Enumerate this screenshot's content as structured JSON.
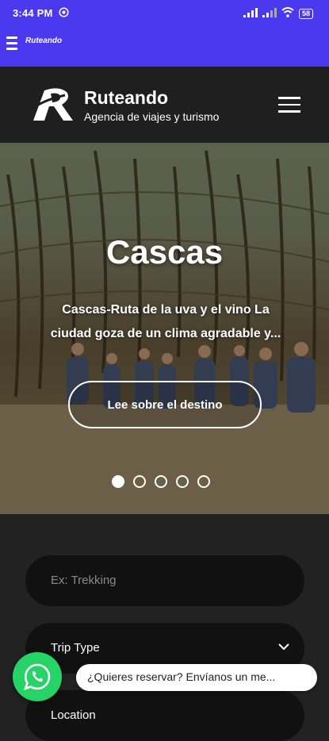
{
  "status_bar": {
    "time": "3:44 PM",
    "battery": "58"
  },
  "app_bar": {
    "logo_text": "Ruteando"
  },
  "header": {
    "brand_name": "Ruteando",
    "tagline": "Agencia de viajes y turismo"
  },
  "hero": {
    "title": "Cascas",
    "description": "Cascas-Ruta de la uva y el vino La ciudad goza de un clima agradable y...",
    "button_label": "Lee sobre el destino",
    "slide_count": 5,
    "active_slide": 1
  },
  "search": {
    "keyword_placeholder": "Ex: Trekking",
    "trip_type_label": "Trip Type",
    "location_label": "Location"
  },
  "whatsapp": {
    "message": "¿Quieres reservar? Envíanos un me..."
  },
  "colors": {
    "accent": "#4b39ef",
    "header_bg": "#1f1f1f",
    "section_bg": "#222222",
    "whatsapp": "#25d366"
  }
}
